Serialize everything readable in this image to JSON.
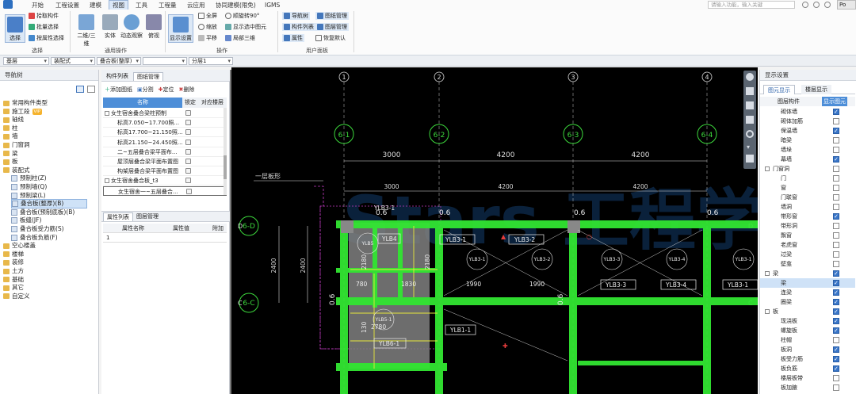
{
  "menu_tabs": [
    "开始",
    "工程设置",
    "建模",
    "视图",
    "工具",
    "工程量",
    "云应用",
    "协同建模(限免)",
    "IGMS"
  ],
  "active_tab": "视图",
  "search_placeholder": "请输入功能，输入关键",
  "account_label": "Po",
  "ribbon": {
    "select_group": {
      "select_btn": "选择",
      "pick": "拾取构件",
      "batch": "批量选择",
      "by_attr": "按属性选择",
      "label": "选择"
    },
    "general_group": {
      "view2d3d": "二维/三维",
      "solid": "实体",
      "dynamic": "动态观察",
      "view": "俯视",
      "label": "通用操作"
    },
    "display_settings": "显示设置",
    "operate_group": {
      "fullscreen": "全屏",
      "zoom": "缩放",
      "pan": "平移",
      "rotate": "顺旋转90°",
      "show_selected": "显示选中图元",
      "local3d": "局部三维",
      "label": "操作"
    },
    "panel_group": {
      "nav_tree": "导航树",
      "comp_list": "构件列表",
      "attr": "属性",
      "drawing_mgmt": "图纸管理",
      "layer_mgmt": "图层管理",
      "restore": "恢复默认",
      "label": "用户面板"
    }
  },
  "combos": [
    "基层",
    "装配式",
    "叠合板(整厚)",
    "",
    "分层1"
  ],
  "nav_tree": {
    "title": "导航树",
    "items": [
      {
        "label": "常用构件类型",
        "level": 0
      },
      {
        "label": "施工段",
        "level": 0,
        "badge": "VIP"
      },
      {
        "label": "轴线",
        "level": 0
      },
      {
        "label": "柱",
        "level": 0
      },
      {
        "label": "墙",
        "level": 0
      },
      {
        "label": "门窗洞",
        "level": 0
      },
      {
        "label": "梁",
        "level": 0
      },
      {
        "label": "板",
        "level": 0
      },
      {
        "label": "装配式",
        "level": 0
      },
      {
        "label": "预制柱(Z)",
        "level": 1
      },
      {
        "label": "预制墙(Q)",
        "level": 1
      },
      {
        "label": "预制梁(L)",
        "level": 1
      },
      {
        "label": "叠合板(整厚)(B)",
        "level": 1,
        "selected": true
      },
      {
        "label": "叠合板(预制底板)(B)",
        "level": 1
      },
      {
        "label": "板缝(JF)",
        "level": 1
      },
      {
        "label": "叠合板受力筋(S)",
        "level": 1
      },
      {
        "label": "叠合板负筋(F)",
        "level": 1
      },
      {
        "label": "空心楼盖",
        "level": 0
      },
      {
        "label": "楼梯",
        "level": 0
      },
      {
        "label": "装修",
        "level": 0
      },
      {
        "label": "土方",
        "level": 0
      },
      {
        "label": "基础",
        "level": 0
      },
      {
        "label": "其它",
        "level": 0
      },
      {
        "label": "自定义",
        "level": 0
      }
    ]
  },
  "drawing_panel": {
    "tabs": [
      "构件列表",
      "图纸管理"
    ],
    "toolbar": {
      "add": "添加图纸",
      "split": "分割",
      "locate": "定位",
      "delete": "删除"
    },
    "headers": [
      "名称",
      "锁定",
      "对应楼层"
    ],
    "rows": [
      "女生宿舍叠合梁柱预制",
      "标高7.050~17.700照...",
      "标高17.700~21.150照...",
      "标高21.150~24.450照...",
      "二~五层叠合梁平面布...",
      "屋顶层叠合梁平面布置图",
      "构架层叠合梁平面布置图",
      "女生宿舍叠合板_t3",
      "女生宿舍一~五层叠合..."
    ]
  },
  "prop_panel": {
    "tabs": [
      "属性列表",
      "图层管理"
    ],
    "headers": [
      "属性名称",
      "属性值",
      "附加"
    ],
    "row_no": "1"
  },
  "display_settings": {
    "title": "显示设置",
    "tabs": [
      "图元显示",
      "楼层显示"
    ],
    "headers": [
      "图层构件",
      "显示图元"
    ],
    "rows": [
      {
        "label": "砌体墙",
        "on": true,
        "level": 1
      },
      {
        "label": "砌体加筋",
        "on": false,
        "level": 1
      },
      {
        "label": "保温墙",
        "on": true,
        "level": 1
      },
      {
        "label": "暗梁",
        "on": false,
        "level": 1
      },
      {
        "label": "墙垛",
        "on": false,
        "level": 1
      },
      {
        "label": "幕墙",
        "on": true,
        "level": 1
      },
      {
        "label": "门窗洞",
        "on": false,
        "level": 0
      },
      {
        "label": "门",
        "on": false,
        "level": 1
      },
      {
        "label": "窗",
        "on": false,
        "level": 1
      },
      {
        "label": "门联窗",
        "on": false,
        "level": 1
      },
      {
        "label": "墙洞",
        "on": false,
        "level": 1
      },
      {
        "label": "带形窗",
        "on": true,
        "level": 1
      },
      {
        "label": "带形洞",
        "on": false,
        "level": 1
      },
      {
        "label": "飘窗",
        "on": false,
        "level": 1
      },
      {
        "label": "老虎窗",
        "on": false,
        "level": 1
      },
      {
        "label": "过梁",
        "on": false,
        "level": 1
      },
      {
        "label": "壁龛",
        "on": false,
        "level": 1
      },
      {
        "label": "梁",
        "on": true,
        "level": 0
      },
      {
        "label": "梁",
        "on": true,
        "level": 1
      },
      {
        "label": "连梁",
        "on": true,
        "level": 1
      },
      {
        "label": "圈梁",
        "on": true,
        "level": 1
      },
      {
        "label": "板",
        "on": true,
        "level": 0
      },
      {
        "label": "现浇板",
        "on": true,
        "level": 1
      },
      {
        "label": "螺旋板",
        "on": true,
        "level": 1
      },
      {
        "label": "柱帽",
        "on": false,
        "level": 1
      },
      {
        "label": "板洞",
        "on": true,
        "level": 1
      },
      {
        "label": "板受力筋",
        "on": true,
        "level": 1
      },
      {
        "label": "板负筋",
        "on": true,
        "level": 1
      },
      {
        "label": "楼层板带",
        "on": false,
        "level": 1
      },
      {
        "label": "板加腋",
        "on": false,
        "level": 1
      }
    ]
  },
  "cad": {
    "col_axes": [
      "1",
      "2",
      "3",
      "4"
    ],
    "col_tags": [
      "6-1",
      "6-2",
      "6-3",
      "6-4"
    ],
    "row_tags": [
      "6-D",
      "6-C"
    ],
    "row_letters": [
      "D",
      "C"
    ],
    "dims_top": [
      "3000",
      "4200",
      "4200"
    ],
    "dims_top2": [
      "3000",
      "4200",
      "4200"
    ],
    "dim_left": "2400",
    "dim_left2": "2400",
    "floor_label": "一层板形",
    "slab_labels": [
      "YLB3-1",
      "YLB3-2",
      "YLB3-1",
      "YLB3-3",
      "YLB3-4",
      "YLB3-1",
      "YLB1-1",
      "YLB5-1",
      "YLB6-1",
      "YLB4",
      "YLB5"
    ],
    "thickness": [
      "0.6",
      "0.6",
      "0.6",
      "0.6",
      "0.6",
      "0.6"
    ],
    "nums": [
      "2180",
      "2180",
      "780",
      "1830",
      "1990",
      "1990",
      "130",
      "2780",
      "1990"
    ],
    "watermark": "Stars 工程学院"
  }
}
